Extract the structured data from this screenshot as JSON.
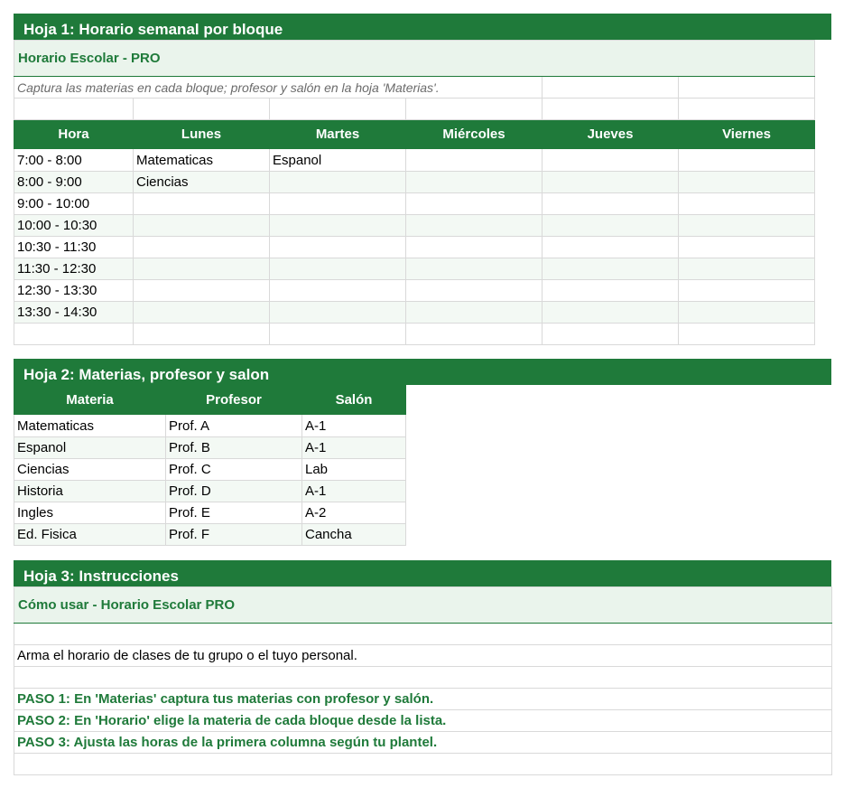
{
  "sheet1": {
    "band": "Hoja 1: Horario semanal por bloque",
    "title": "Horario Escolar - PRO",
    "subtitle": "Captura las materias en cada bloque; profesor y salón en la hoja 'Materias'.",
    "headers": [
      "Hora",
      "Lunes",
      "Martes",
      "Miércoles",
      "Jueves",
      "Viernes"
    ],
    "rows": [
      [
        "7:00 - 8:00",
        "Matematicas",
        "Espanol",
        "",
        "",
        ""
      ],
      [
        "8:00 - 9:00",
        "Ciencias",
        "",
        "",
        "",
        ""
      ],
      [
        "9:00 - 10:00",
        "",
        "",
        "",
        "",
        ""
      ],
      [
        "10:00 - 10:30",
        "",
        "",
        "",
        "",
        ""
      ],
      [
        "10:30 - 11:30",
        "",
        "",
        "",
        "",
        ""
      ],
      [
        "11:30 - 12:30",
        "",
        "",
        "",
        "",
        ""
      ],
      [
        "12:30 - 13:30",
        "",
        "",
        "",
        "",
        ""
      ],
      [
        "13:30 - 14:30",
        "",
        "",
        "",
        "",
        ""
      ]
    ]
  },
  "sheet2": {
    "band": "Hoja 2: Materias, profesor y salon",
    "headers": [
      "Materia",
      "Profesor",
      "Salón"
    ],
    "rows": [
      [
        "Matematicas",
        "Prof. A",
        "A-1"
      ],
      [
        "Espanol",
        "Prof. B",
        "A-1"
      ],
      [
        "Ciencias",
        "Prof. C",
        "Lab"
      ],
      [
        "Historia",
        "Prof. D",
        "A-1"
      ],
      [
        "Ingles",
        "Prof. E",
        "A-2"
      ],
      [
        "Ed. Fisica",
        "Prof. F",
        "Cancha"
      ]
    ]
  },
  "sheet3": {
    "band": "Hoja 3: Instrucciones",
    "title": "Cómo usar - Horario Escolar PRO",
    "intro": "Arma el horario de clases de tu grupo o el tuyo personal.",
    "steps": [
      "PASO 1: En 'Materias' captura tus materias con profesor y salón.",
      "PASO 2: En 'Horario' elige la materia de cada bloque desde la lista.",
      "PASO 3: Ajusta las horas de la primera columna según tu plantel."
    ]
  },
  "colors": {
    "accent": "#1f7a3a",
    "title_bg": "#eaf4ec",
    "alt_row": "#f3f9f4",
    "grid": "#d9d9d9"
  }
}
